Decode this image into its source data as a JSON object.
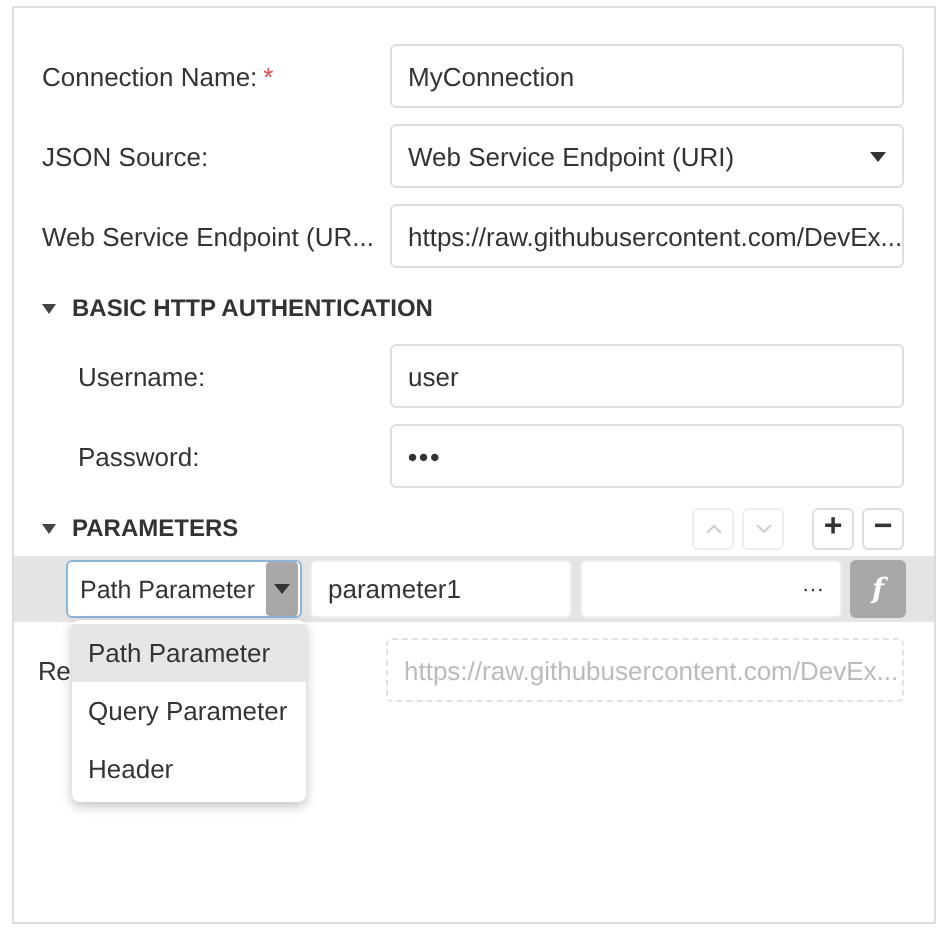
{
  "fields": [
    {
      "label": "Connection Name:",
      "required_mark": "*",
      "kind": "text",
      "value": "MyConnection"
    },
    {
      "label": "JSON Source:",
      "kind": "select",
      "value": "Web Service Endpoint (URI)"
    },
    {
      "label": "Web Service Endpoint (UR...",
      "kind": "text",
      "value": "https://raw.githubusercontent.com/DevEx..."
    }
  ],
  "auth": {
    "title": "BASIC HTTP AUTHENTICATION",
    "expanded": true,
    "fields": [
      {
        "label": "Username:",
        "kind": "text",
        "value": "user"
      },
      {
        "label": "Password:",
        "kind": "password",
        "value": "•••"
      }
    ]
  },
  "parameters": {
    "title": "PARAMETERS",
    "expanded": true,
    "buttons": [
      {
        "kind": "up",
        "disabled": true
      },
      {
        "kind": "down",
        "disabled": true
      },
      {
        "kind": "add",
        "label": "+",
        "disabled": false
      },
      {
        "kind": "remove",
        "label": "−",
        "disabled": false
      }
    ],
    "row": {
      "type": "Path Parameter",
      "name": "parameter1",
      "value_button": "···",
      "expr_button": "f"
    },
    "dropdown": [
      {
        "label": "Path Parameter",
        "selected": true
      },
      {
        "label": "Query Parameter",
        "selected": false
      },
      {
        "label": "Header",
        "selected": false
      }
    ]
  },
  "resulting": {
    "label": "Re",
    "placeholder": "https://raw.githubusercontent.com/DevEx..."
  }
}
